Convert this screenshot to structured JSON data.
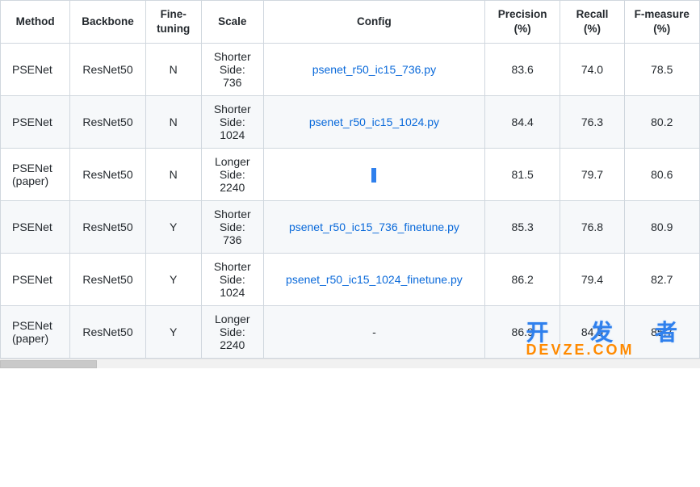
{
  "table": {
    "headers": {
      "method": "Method",
      "backbone": "Backbone",
      "finetuning": "Fine-tuning",
      "scale": "Scale",
      "config": "Config",
      "precision": "Precision (%)",
      "recall": "Recall (%)",
      "fmeasure": "F-measure (%)"
    },
    "rows": [
      {
        "method": "PSENet",
        "backbone": "ResNet50",
        "finetuning": "N",
        "scale": "Shorter Side: 736",
        "config": "psenet_r50_ic15_736.py",
        "config_is_link": true,
        "precision": "83.6",
        "recall": "74.0",
        "fmeasure": "78.5"
      },
      {
        "method": "PSENet",
        "backbone": "ResNet50",
        "finetuning": "N",
        "scale": "Shorter Side: 1024",
        "config": "psenet_r50_ic15_1024.py",
        "config_is_link": true,
        "precision": "84.4",
        "recall": "76.3",
        "fmeasure": "80.2"
      },
      {
        "method": "PSENet (paper)",
        "backbone": "ResNet50",
        "finetuning": "N",
        "scale": "Longer Side: 2240",
        "config": "-",
        "config_is_link": false,
        "config_highlighted": true,
        "precision": "81.5",
        "recall": "79.7",
        "fmeasure": "80.6"
      },
      {
        "method": "PSENet",
        "backbone": "ResNet50",
        "finetuning": "Y",
        "scale": "Shorter Side: 736",
        "config": "psenet_r50_ic15_736_finetune.py",
        "config_is_link": true,
        "precision": "85.3",
        "recall": "76.8",
        "fmeasure": "80.9"
      },
      {
        "method": "PSENet",
        "backbone": "ResNet50",
        "finetuning": "Y",
        "scale": "Shorter Side: 1024",
        "config": "psenet_r50_ic15_1024_finetune.py",
        "config_is_link": true,
        "precision": "86.2",
        "recall": "79.4",
        "fmeasure": "82.7"
      },
      {
        "method": "PSENet (paper)",
        "backbone": "ResNet50",
        "finetuning": "Y",
        "scale": "Longer Side: 2240",
        "config": "-",
        "config_is_link": false,
        "precision": "86.9",
        "recall": "84.5",
        "fmeasure": "85.7"
      }
    ]
  },
  "watermark": {
    "cn": "开 发 者",
    "en": "DEVZE.COM"
  }
}
